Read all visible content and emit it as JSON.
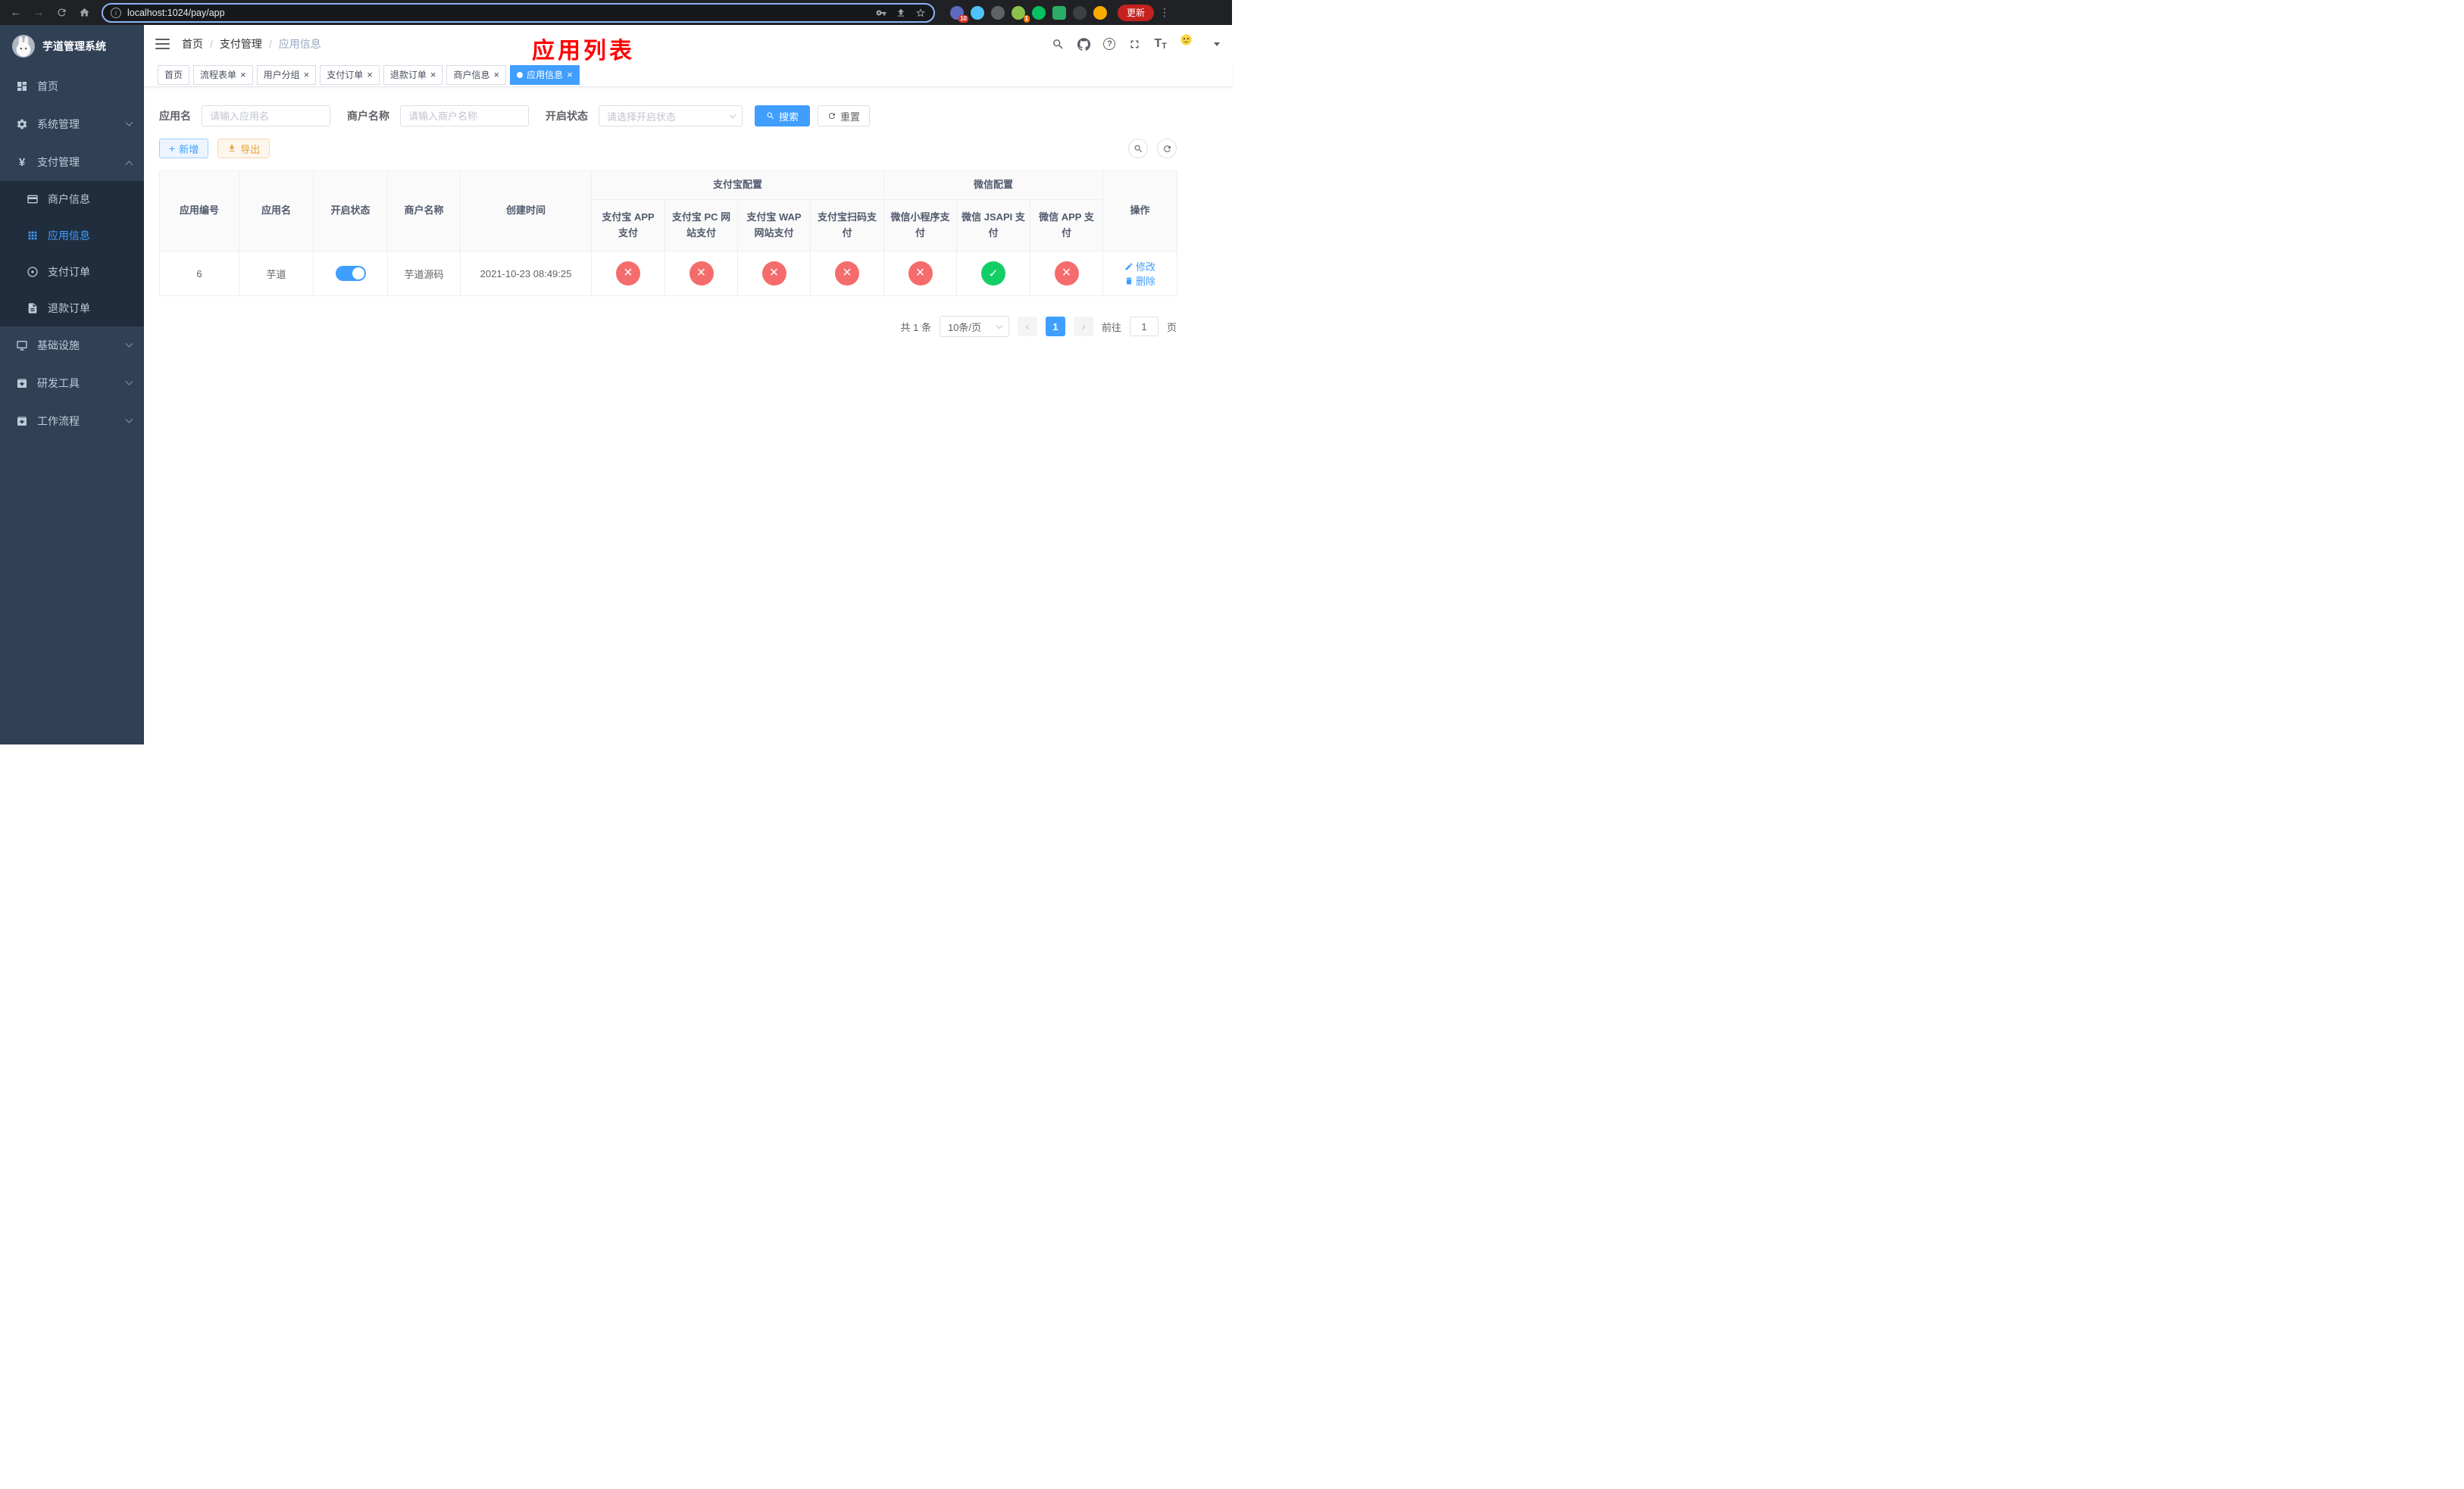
{
  "colors": {
    "accent": "#409eff",
    "danger": "#f56c6c",
    "success": "#13ce66",
    "warning": "#e6a23c",
    "annotation": "#ff0000"
  },
  "icons": {
    "back": "←",
    "forward": "→",
    "info_letter": "i",
    "more": "⋮",
    "close": "×",
    "plus": "+",
    "yen": "¥",
    "question": "?",
    "prev": "‹",
    "next": "›",
    "letter_t": "T"
  },
  "browser": {
    "url": "localhost:1024/pay/app",
    "update_label": "更新",
    "ext_badges": {
      "first": "10",
      "second": "1"
    }
  },
  "sidebar": {
    "title": "芋道管理系统",
    "items": [
      {
        "label": "首页"
      },
      {
        "label": "系统管理"
      },
      {
        "label": "支付管理",
        "children": [
          {
            "label": "商户信息"
          },
          {
            "label": "应用信息"
          },
          {
            "label": "支付订单"
          },
          {
            "label": "退款订单"
          }
        ]
      },
      {
        "label": "基础设施"
      },
      {
        "label": "研发工具"
      },
      {
        "label": "工作流程"
      }
    ]
  },
  "navbar": {
    "breadcrumb": [
      "首页",
      "支付管理",
      "应用信息"
    ],
    "annotation": "应用列表"
  },
  "tabs": [
    {
      "label": "首页",
      "closable": false,
      "active": false
    },
    {
      "label": "流程表单",
      "closable": true,
      "active": false
    },
    {
      "label": "用户分组",
      "closable": true,
      "active": false
    },
    {
      "label": "支付订单",
      "closable": true,
      "active": false
    },
    {
      "label": "退款订单",
      "closable": true,
      "active": false
    },
    {
      "label": "商户信息",
      "closable": true,
      "active": false
    },
    {
      "label": "应用信息",
      "closable": true,
      "active": true
    }
  ],
  "filters": {
    "app_name": {
      "label": "应用名",
      "placeholder": "请输入应用名",
      "value": ""
    },
    "merchant_name": {
      "label": "商户名称",
      "placeholder": "请输入商户名称",
      "value": ""
    },
    "status": {
      "label": "开启状态",
      "placeholder": "请选择开启状态"
    },
    "search_label": "搜索",
    "reset_label": "重置"
  },
  "toolbar": {
    "add_label": "新增",
    "export_label": "导出"
  },
  "table": {
    "columns": {
      "id": "应用编号",
      "name": "应用名",
      "status": "开启状态",
      "merchant": "商户名称",
      "created": "创建时间",
      "actions": "操作",
      "alipay_group": "支付宝配置",
      "wechat_group": "微信配置",
      "alipay_app": "支付宝 APP 支付",
      "alipay_pc": "支付宝 PC 网站支付",
      "alipay_wap": "支付宝 WAP 网站支付",
      "alipay_qr": "支付宝扫码支付",
      "wx_mini": "微信小程序支付",
      "wx_jsapi": "微信 JSAPI 支付",
      "wx_app": "微信 APP 支付"
    },
    "rows": [
      {
        "id": "6",
        "name": "芋道",
        "status_enabled": true,
        "merchant": "芋道源码",
        "created": "2021-10-23 08:49:25",
        "alipay_app": "disabled",
        "alipay_pc": "disabled",
        "alipay_wap": "disabled",
        "alipay_qr": "disabled",
        "wx_mini": "disabled",
        "wx_jsapi": "enabled",
        "wx_app": "disabled",
        "edit_label": "修改",
        "delete_label": "删除"
      }
    ]
  },
  "pagination": {
    "total": "共 1 条",
    "page_size": "10条/页",
    "page": "1",
    "goto_prefix": "前往",
    "goto_value": "1",
    "goto_suffix": "页"
  }
}
